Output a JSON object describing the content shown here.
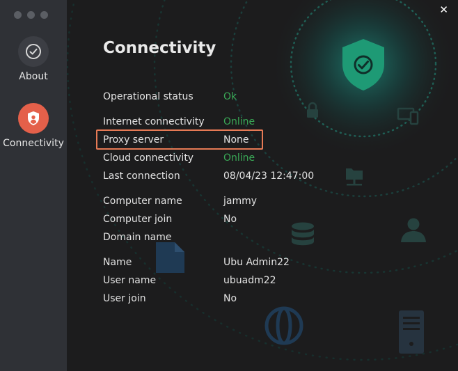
{
  "sidebar": {
    "items": [
      {
        "label": "About",
        "icon": "check-circle-icon"
      },
      {
        "label": "Connectivity",
        "icon": "shield-user-icon"
      }
    ]
  },
  "window": {
    "close_label": "✕"
  },
  "page": {
    "title": "Connectivity",
    "groups": [
      [
        {
          "label": "Operational status",
          "value": "Ok"
        },
        {
          "label": "Internet connectivity",
          "value": "Online"
        },
        {
          "label": "Proxy server",
          "value": "None"
        },
        {
          "label": "Cloud connectivity",
          "value": "Online"
        },
        {
          "label": "Last connection",
          "value": "08/04/23 12:47:00"
        }
      ],
      [
        {
          "label": "Computer name",
          "value": "jammy"
        },
        {
          "label": "Computer join",
          "value": "No"
        },
        {
          "label": "Domain name",
          "value": ""
        }
      ],
      [
        {
          "label": "Name",
          "value": "Ubu Admin22"
        },
        {
          "label": "User name",
          "value": "ubuadm22"
        },
        {
          "label": "User join",
          "value": "No"
        }
      ]
    ]
  },
  "colors": {
    "accent": "#e4604a",
    "status_ok": "#3aa856",
    "highlight": "#e67a55",
    "shield": "#1e9a75"
  }
}
